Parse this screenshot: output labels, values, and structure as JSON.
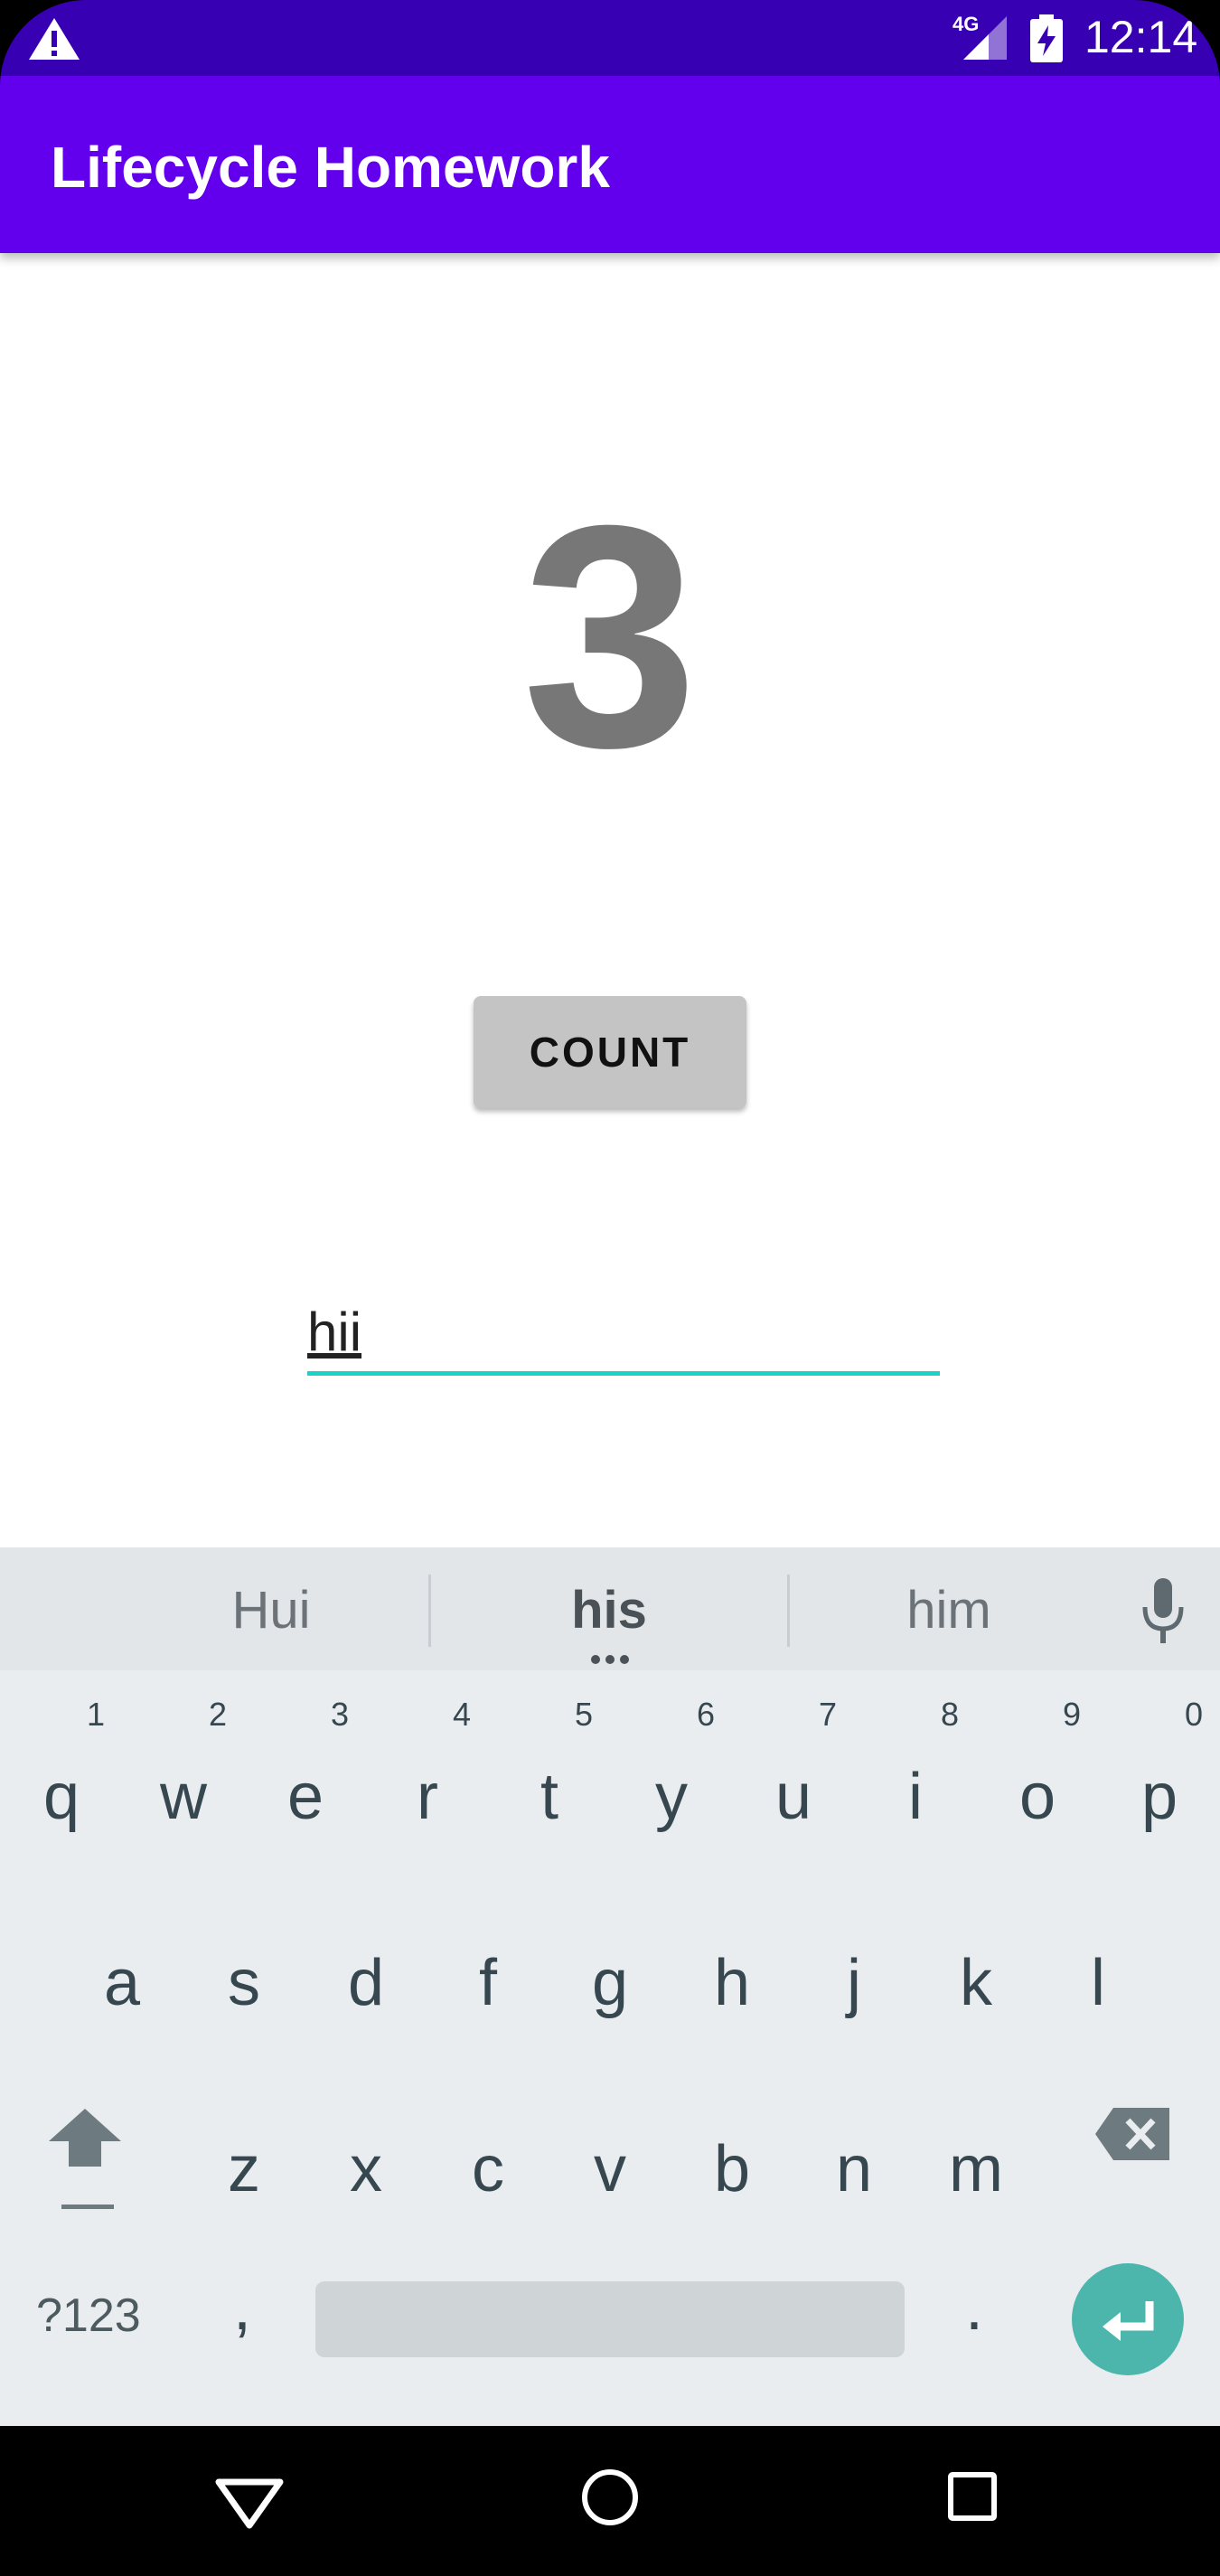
{
  "status_bar": {
    "network_label": "4G",
    "time": "12:14",
    "icons": [
      "warning-icon",
      "signal-icon",
      "battery-charging-icon"
    ]
  },
  "app_bar": {
    "title": "Lifecycle Homework"
  },
  "counter": {
    "value": "3"
  },
  "count_button": {
    "label": "COUNT"
  },
  "text_field": {
    "value": "hii",
    "underline_color": "#1dd1c8"
  },
  "keyboard": {
    "suggestions": [
      "Hui",
      "his",
      "him"
    ],
    "row1": [
      {
        "letter": "q",
        "num": "1"
      },
      {
        "letter": "w",
        "num": "2"
      },
      {
        "letter": "e",
        "num": "3"
      },
      {
        "letter": "r",
        "num": "4"
      },
      {
        "letter": "t",
        "num": "5"
      },
      {
        "letter": "y",
        "num": "6"
      },
      {
        "letter": "u",
        "num": "7"
      },
      {
        "letter": "i",
        "num": "8"
      },
      {
        "letter": "o",
        "num": "9"
      },
      {
        "letter": "p",
        "num": "0"
      }
    ],
    "row2": [
      "a",
      "s",
      "d",
      "f",
      "g",
      "h",
      "j",
      "k",
      "l"
    ],
    "row3": [
      "z",
      "x",
      "c",
      "v",
      "b",
      "n",
      "m"
    ],
    "symbols_label": "?123",
    "comma": ",",
    "period": ".",
    "enter_color": "#4db6ac"
  },
  "colors": {
    "status_bar": "#3700B3",
    "app_bar": "#6200EE",
    "keyboard_bg": "#e9edf0"
  }
}
